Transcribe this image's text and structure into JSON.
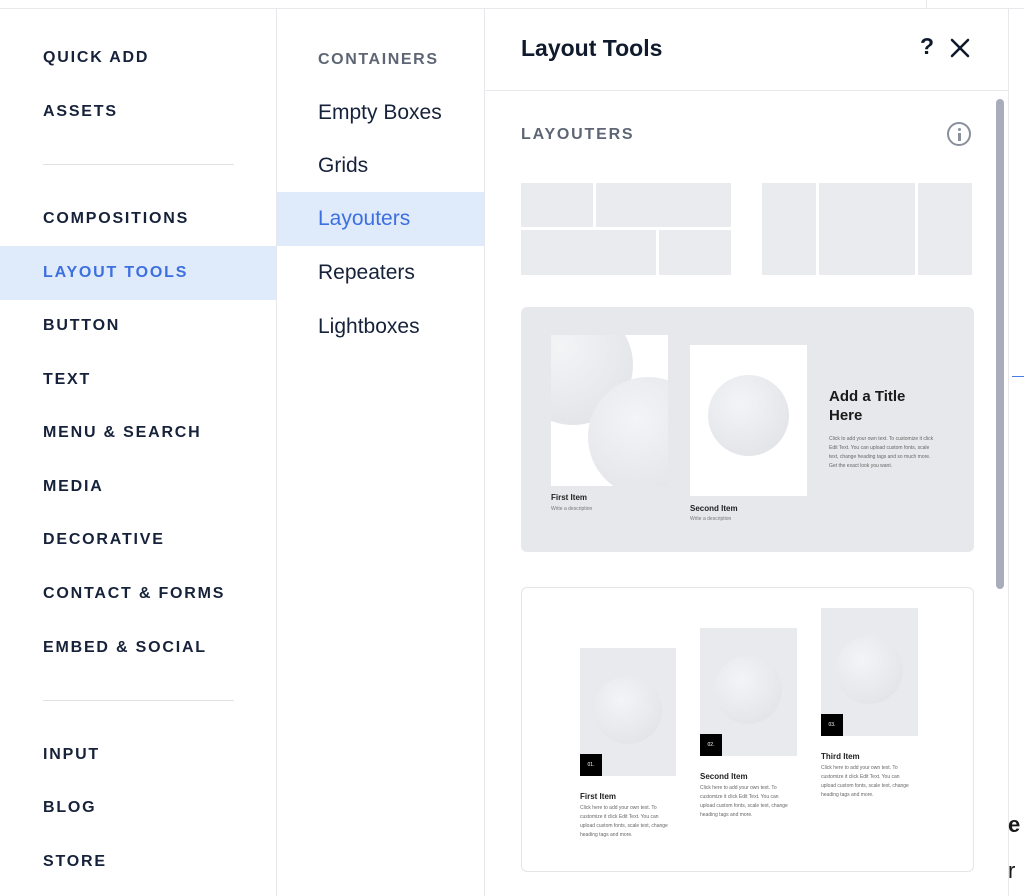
{
  "categories": [
    {
      "label": "QUICK ADD"
    },
    {
      "label": "ASSETS"
    },
    {
      "label": "COMPOSITIONS"
    },
    {
      "label": "LAYOUT TOOLS"
    },
    {
      "label": "BUTTON"
    },
    {
      "label": "TEXT"
    },
    {
      "label": "MENU & SEARCH"
    },
    {
      "label": "MEDIA"
    },
    {
      "label": "DECORATIVE"
    },
    {
      "label": "CONTACT & FORMS"
    },
    {
      "label": "EMBED & SOCIAL"
    },
    {
      "label": "INPUT"
    },
    {
      "label": "BLOG"
    },
    {
      "label": "STORE"
    }
  ],
  "active_category": "LAYOUT TOOLS",
  "subcategories": {
    "header": "CONTAINERS",
    "items": [
      {
        "label": "Empty Boxes"
      },
      {
        "label": "Grids"
      },
      {
        "label": "Layouters"
      },
      {
        "label": "Repeaters"
      },
      {
        "label": "Lightboxes"
      }
    ],
    "active": "Layouters"
  },
  "panel": {
    "title": "Layout Tools",
    "help_label": "?",
    "close_icon": "close-icon",
    "section_label": "LAYOUTERS",
    "info_icon": "info-icon"
  },
  "preset_two_items": {
    "title": "Add a Title Here",
    "body": "Click to add your own text. To customize it click Edit Text. You can upload custom fonts, scale text, change heading tags and so much more. Get the exact look you want.",
    "items": [
      {
        "title": "First Item",
        "desc": "Write a description"
      },
      {
        "title": "Second Item",
        "desc": "Write a description"
      }
    ]
  },
  "preset_three_items": {
    "items": [
      {
        "num": "01.",
        "title": "First Item",
        "desc": "Click here to add your own text. To customize it click Edit Text. You can upload custom fonts, scale text, change heading tags and more."
      },
      {
        "num": "02.",
        "title": "Second Item",
        "desc": "Click here to add your own text. To customize it click Edit Text. You can upload custom fonts, scale text, change heading tags and more."
      },
      {
        "num": "03.",
        "title": "Third Item",
        "desc": "Click here to add your own text. To customize it click Edit Text. You can upload custom fonts, scale text, change heading tags and more."
      }
    ]
  },
  "page_peek": {
    "char_top": "e",
    "char_bottom": "r"
  },
  "colors": {
    "accent": "#3d6fe0",
    "active_bg": "#dfeafb",
    "text_dark": "#16213a",
    "text_muted": "#5e6675"
  }
}
